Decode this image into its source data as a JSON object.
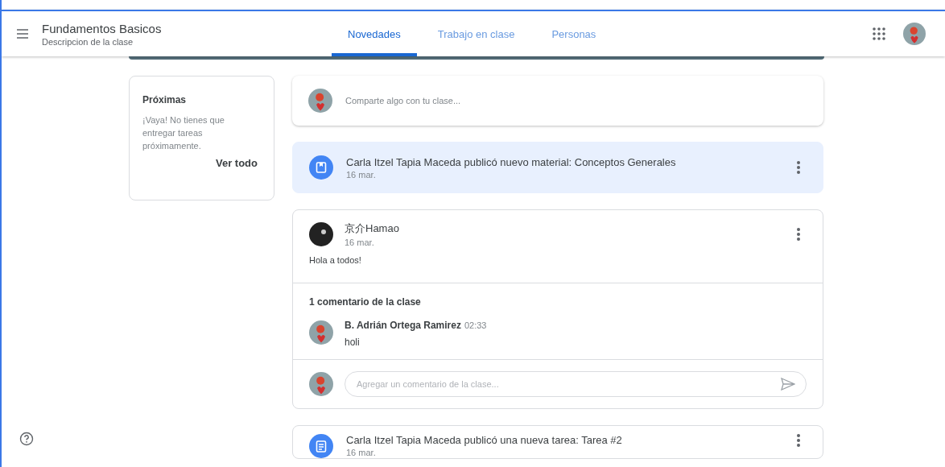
{
  "header": {
    "title": "Fundamentos Basicos",
    "subtitle": "Descripcion de la clase"
  },
  "tabs": [
    {
      "label": "Novedades",
      "selected": true
    },
    {
      "label": "Trabajo en clase",
      "selected": false
    },
    {
      "label": "Personas",
      "selected": false
    }
  ],
  "upcoming": {
    "title": "Próximas",
    "message": "¡Vaya! No tienes que entregar tareas próximamente.",
    "link": "Ver todo"
  },
  "compose": {
    "placeholder": "Comparte algo con tu clase..."
  },
  "stream": [
    {
      "kind": "material",
      "title": "Carla Itzel Tapia Maceda publicó nuevo material: Conceptos Generales",
      "date": "16 mar.",
      "highlighted": true
    },
    {
      "kind": "post",
      "author": "京介Hamao",
      "date": "16 mar.",
      "text": "Hola a todos!",
      "comments_heading": "1 comentario de la clase",
      "comments": [
        {
          "author": "B. Adrián Ortega Ramirez",
          "time": "02:33",
          "text": "holi"
        }
      ],
      "reply_placeholder": "Agregar un comentario de la clase..."
    },
    {
      "kind": "assignment",
      "title": "Carla Itzel Tapia Maceda publicó una nueva tarea: Tarea #2",
      "date": "16 mar.",
      "highlighted": false
    }
  ]
}
